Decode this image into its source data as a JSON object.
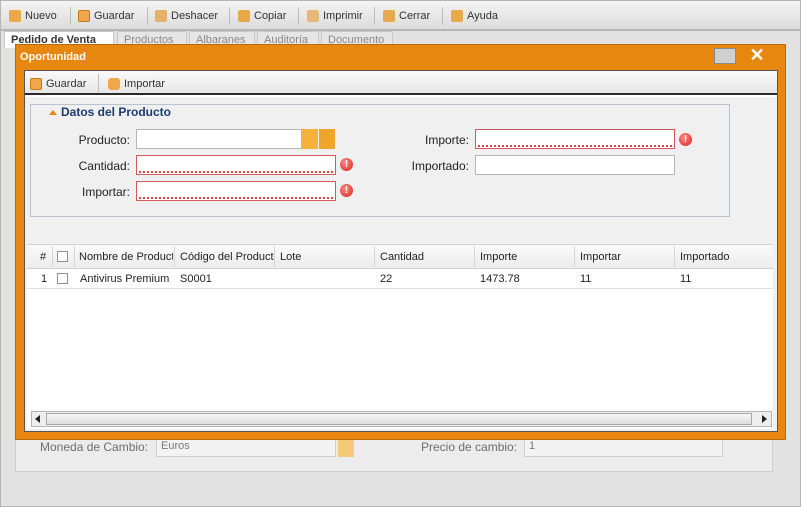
{
  "toolbar": {
    "nuevo": "Nuevo",
    "guardar": "Guardar",
    "deshacer": "Deshacer",
    "copiar": "Copiar",
    "imprimir": "Imprimir",
    "cerrar": "Cerrar",
    "ayuda": "Ayuda"
  },
  "tabs": [
    "Pedido de Venta",
    "Productos",
    "Albaranes",
    "Auditoría",
    "Documento"
  ],
  "background_form": {
    "moneda_label": "Moneda de Cambio:",
    "moneda_value": "Euros",
    "precio_label": "Precio de cambio:",
    "precio_value": "1"
  },
  "modal": {
    "title": "Oportunidad",
    "toolbar": {
      "guardar": "Guardar",
      "importar": "Importar"
    },
    "section_title": "Datos del Producto",
    "fields": {
      "producto_label": "Producto:",
      "producto_value": "",
      "cantidad_label": "Cantidad:",
      "cantidad_value": "",
      "importar_label": "Importar:",
      "importar_value": "",
      "importe_label": "Importe:",
      "importe_value": "",
      "importado_label": "Importado:",
      "importado_value": ""
    },
    "error_icon": "!",
    "grid": {
      "columns": [
        "#",
        "Nombre de Producto",
        "Código del Producto",
        "Lote",
        "Cantidad",
        "Importe",
        "Importar",
        "Importado"
      ],
      "rows": [
        {
          "num": "1",
          "nombre": "Antivirus Premium",
          "codigo": "S0001",
          "lote": "",
          "cantidad": "22",
          "importe": "1473.78",
          "importar": "11",
          "importado": "11"
        }
      ]
    }
  },
  "colors": {
    "modal_frame": "#e8870f",
    "section_title": "#1c3b70",
    "error": "#d22"
  }
}
